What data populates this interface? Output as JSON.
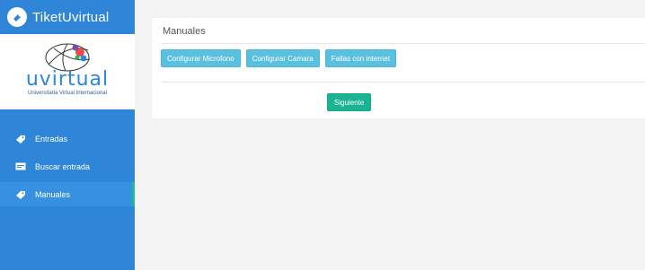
{
  "app": {
    "title": "TiketUvirtual"
  },
  "logo": {
    "word": "uvirtual",
    "subtitle": "Universitaria Virtual Internacional"
  },
  "sidebar": {
    "items": [
      {
        "label": "Entradas",
        "icon": "tag-icon",
        "active": false
      },
      {
        "label": "Buscar entrada",
        "icon": "card-icon",
        "active": false
      },
      {
        "label": "Manuales",
        "icon": "tag-icon",
        "active": true
      }
    ]
  },
  "panel": {
    "title": "Manuales",
    "buttons": [
      "Configurar Microfono",
      "Configurar Camara",
      "Fallas con internet"
    ],
    "next_label": "Siguiente"
  },
  "colors": {
    "sidebar": "#2f86d8",
    "info_button": "#5bc0de",
    "primary_button": "#1ab394"
  }
}
